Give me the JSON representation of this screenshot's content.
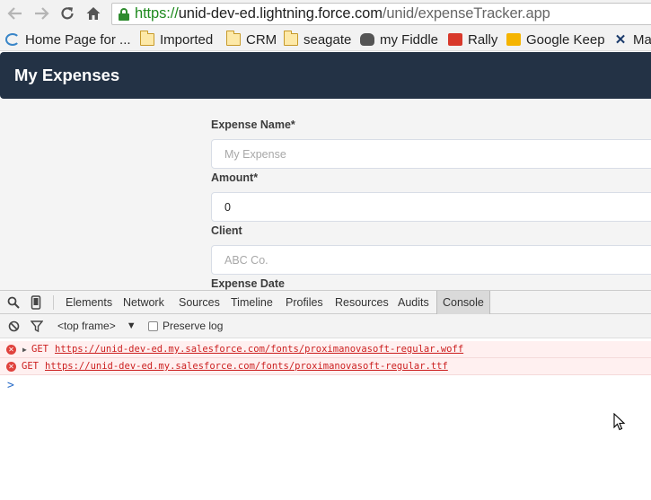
{
  "browser": {
    "back_icon": "arrow-left-icon",
    "forward_icon": "arrow-right-icon",
    "reload_icon": "reload-icon",
    "home_icon": "home-icon",
    "url_scheme": "https://",
    "url_host": "unid-dev-ed.lightning.force.com",
    "url_path": "/unid/expenseTracker.app"
  },
  "bookmarks": [
    {
      "label": "Home Page for ...",
      "icon": "salesforce-icon"
    },
    {
      "label": "Imported",
      "icon": "folder-icon"
    },
    {
      "label": "CRM",
      "icon": "folder-icon"
    },
    {
      "label": "seagate",
      "icon": "folder-icon"
    },
    {
      "label": "my Fiddle",
      "icon": "cloud-icon"
    },
    {
      "label": "Rally",
      "icon": "rally-icon"
    },
    {
      "label": "Google Keep",
      "icon": "keep-icon"
    },
    {
      "label": "Ma",
      "icon": "x-icon"
    }
  ],
  "app": {
    "title": "My Expenses"
  },
  "form": {
    "expense_name_label": "Expense Name*",
    "expense_name_placeholder": "My Expense",
    "amount_label": "Amount*",
    "amount_value": "0",
    "client_label": "Client",
    "client_placeholder": "ABC Co.",
    "expense_date_label": "Expense Date"
  },
  "devtools": {
    "tabs": [
      "Elements",
      "Network",
      "Sources",
      "Timeline",
      "Profiles",
      "Resources",
      "Audits",
      "Console"
    ],
    "active_tab": "Console",
    "frame_selector": "<top frame>",
    "preserve_log_label": "Preserve log",
    "console": [
      {
        "method": "GET",
        "url": "https://unid-dev-ed.my.salesforce.com/fonts/proximanovasoft-regular.woff",
        "expandable": true
      },
      {
        "method": "GET",
        "url": "https://unid-dev-ed.my.salesforce.com/fonts/proximanovasoft-regular.ttf",
        "expandable": false
      }
    ],
    "prompt": ">"
  },
  "colors": {
    "header_bg": "#233245",
    "error_text": "#cc1f1f",
    "error_bg": "#fff0f0",
    "secure_green": "#1f8a1f"
  }
}
